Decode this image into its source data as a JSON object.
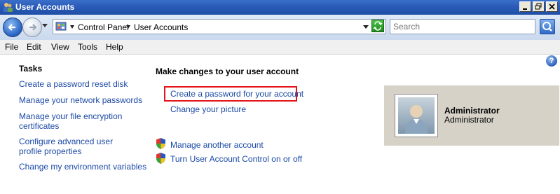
{
  "window": {
    "title": "User Accounts"
  },
  "address": {
    "crumbs": [
      "Control Panel",
      "User Accounts"
    ]
  },
  "search": {
    "placeholder": "Search"
  },
  "menu": [
    "File",
    "Edit",
    "View",
    "Tools",
    "Help"
  ],
  "tasks": {
    "heading": "Tasks",
    "links": [
      "Create a password reset disk",
      "Manage your network passwords",
      "Manage your file encryption certificates",
      "Configure advanced user profile properties",
      "Change my environment variables"
    ]
  },
  "main": {
    "heading": "Make changes to your user account",
    "links": [
      "Create a password for your account",
      "Change your picture"
    ],
    "admin_links": [
      "Manage another account",
      "Turn User Account Control on or off"
    ]
  },
  "user": {
    "name": "Administrator",
    "role": "Administrator"
  },
  "colors": {
    "link": "#1c4aa6",
    "highlight": "#e5141b",
    "titlebar": "#2a5bb8"
  }
}
